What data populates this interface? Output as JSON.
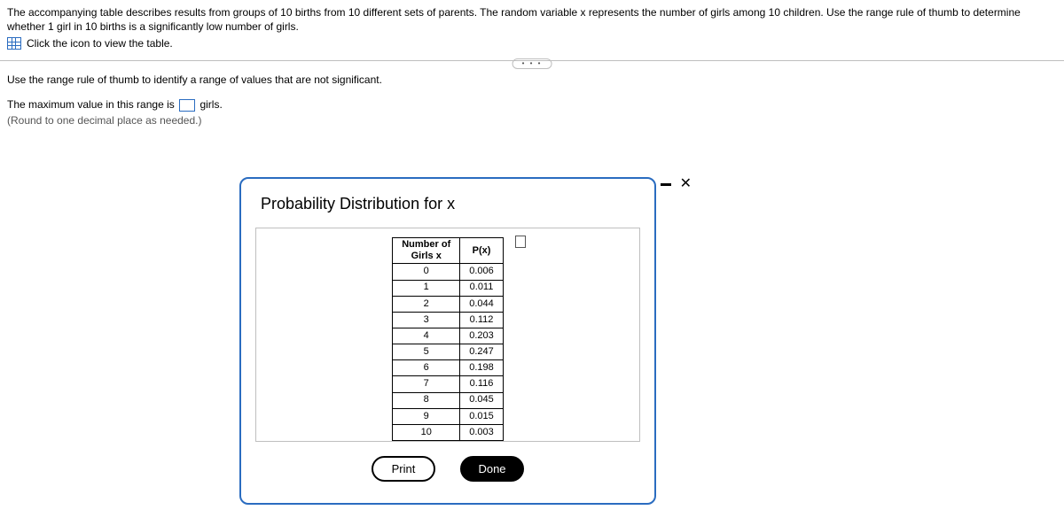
{
  "problem": {
    "description": "The accompanying table describes results from groups of 10 births from 10 different sets of parents. The random variable x represents the number of girls among 10 children. Use the range rule of thumb to determine whether 1 girl in 10 births is a significantly low number of girls.",
    "icon_label": "Click the icon to view the table."
  },
  "overflow_dots": "• • •",
  "instruction": "Use the range rule of thumb to identify a range of values that are not significant.",
  "answer_line": {
    "prefix": "The maximum value in this range is",
    "suffix": "girls."
  },
  "hint": "(Round to one decimal place as needed.)",
  "modal": {
    "title": "Probability Distribution for x",
    "table": {
      "header_left": "Number of Girls x",
      "header_right": "P(x)",
      "rows": [
        {
          "x": "0",
          "p": "0.006"
        },
        {
          "x": "1",
          "p": "0.011"
        },
        {
          "x": "2",
          "p": "0.044"
        },
        {
          "x": "3",
          "p": "0.112"
        },
        {
          "x": "4",
          "p": "0.203"
        },
        {
          "x": "5",
          "p": "0.247"
        },
        {
          "x": "6",
          "p": "0.198"
        },
        {
          "x": "7",
          "p": "0.116"
        },
        {
          "x": "8",
          "p": "0.045"
        },
        {
          "x": "9",
          "p": "0.015"
        },
        {
          "x": "10",
          "p": "0.003"
        }
      ]
    },
    "buttons": {
      "print": "Print",
      "done": "Done"
    }
  }
}
